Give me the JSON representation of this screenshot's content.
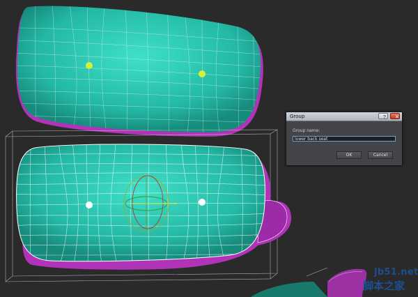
{
  "dialog": {
    "title": "Group",
    "help_label": "?",
    "close_label": "✕",
    "group_name_label": "Group name:",
    "group_name_value": "lower back seat",
    "ok_label": "OK",
    "cancel_label": "Cancel"
  },
  "watermark": {
    "url": "jb51.net",
    "site_name": "脚本之家"
  },
  "colors": {
    "viewport_bg": "#2a2a2a",
    "cushion": "#2ec9b4",
    "underside": "#b033b8",
    "wire": "#ffffff",
    "dialog_bg": "#444548",
    "input_border": "#6fa0d8",
    "watermark": "#1d4f91"
  }
}
